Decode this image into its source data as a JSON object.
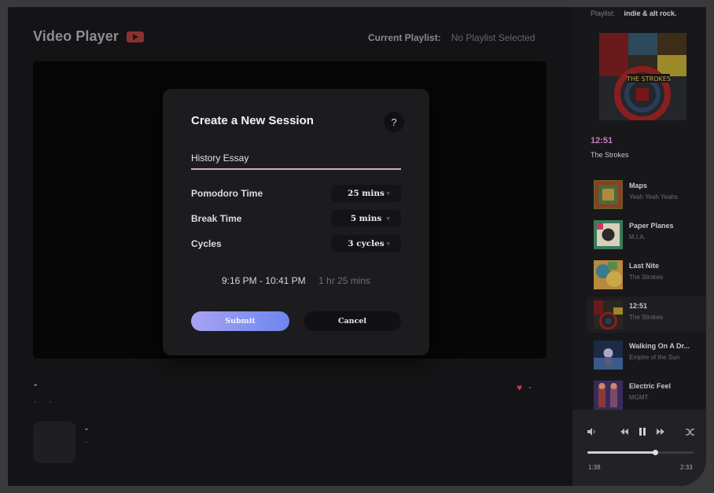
{
  "header": {
    "title": "Video Player",
    "playlist_label": "Current Playlist:",
    "playlist_value": "No Playlist Selected"
  },
  "video_info": {
    "title": "-",
    "meta_a": "-",
    "meta_b": "-",
    "likes": "-",
    "channel_name": "-",
    "channel_sub": "-"
  },
  "modal": {
    "title": "Create a New Session",
    "help": "?",
    "session_name": "History Essay",
    "options": [
      {
        "label": "Pomodoro Time",
        "value": "25 mins"
      },
      {
        "label": "Break Time",
        "value": "5 mins"
      },
      {
        "label": "Cycles",
        "value": "3 cycles"
      }
    ],
    "time_range": "9:16 PM - 10:41 PM",
    "duration": "1 hr 25 mins",
    "submit": "Submit",
    "cancel": "Cancel"
  },
  "sidebar": {
    "playlist_label": "Playlist:",
    "playlist_name": "indie & alt rock.",
    "now_playing": {
      "title": "12:51",
      "artist": "The Strokes"
    },
    "tracks": [
      {
        "title": "Maps",
        "artist": "Yeah Yeah Yeahs"
      },
      {
        "title": "Paper Planes",
        "artist": "M.I.A."
      },
      {
        "title": "Last Nite",
        "artist": "The Strokes"
      },
      {
        "title": "12:51",
        "artist": "The Strokes"
      },
      {
        "title": "Walking On A Dr...",
        "artist": "Empire of the Sun"
      },
      {
        "title": "Electric Feel",
        "artist": "MGMT"
      }
    ],
    "player": {
      "current": "1:38",
      "total": "2:33",
      "progress": 0.64
    }
  },
  "icons": {
    "brand": "youtube-icon",
    "volume": "volume-icon",
    "prev": "rewind-icon",
    "pause": "pause-icon",
    "next": "forward-icon",
    "shuffle": "shuffle-icon",
    "like": "heart-icon"
  },
  "colors": {
    "accent_pink": "#c27fbd",
    "submit_gradient_start": "#a7a3f2",
    "submit_gradient_end": "#6d86ee",
    "heart": "#c23b5a",
    "youtube_red": "#8a3232"
  }
}
